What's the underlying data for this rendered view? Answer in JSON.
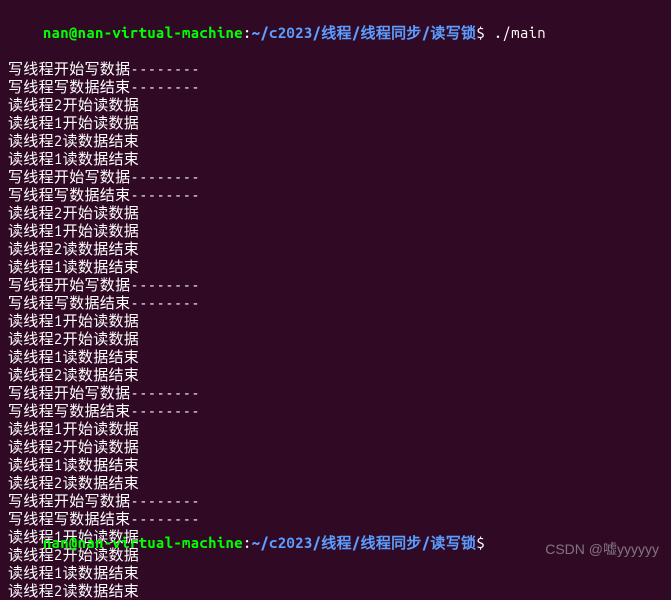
{
  "prompt": {
    "user": "nan@nan-virtual-machine",
    "sep": ":",
    "path": "~/c2023/线程/线程同步/读写锁",
    "symbol": "$",
    "command": " ./main"
  },
  "lines": [
    "写线程开始写数据--------",
    "写线程写数据结束--------",
    "读线程2开始读数据",
    "读线程1开始读数据",
    "读线程2读数据结束",
    "读线程1读数据结束",
    "写线程开始写数据--------",
    "写线程写数据结束--------",
    "读线程2开始读数据",
    "读线程1开始读数据",
    "读线程2读数据结束",
    "读线程1读数据结束",
    "写线程开始写数据--------",
    "写线程写数据结束--------",
    "读线程1开始读数据",
    "读线程2开始读数据",
    "读线程1读数据结束",
    "读线程2读数据结束",
    "写线程开始写数据--------",
    "写线程写数据结束--------",
    "读线程1开始读数据",
    "读线程2开始读数据",
    "读线程1读数据结束",
    "读线程2读数据结束",
    "写线程开始写数据--------",
    "写线程写数据结束--------",
    "读线程1开始读数据",
    "读线程2开始读数据",
    "读线程1读数据结束",
    "读线程2读数据结束"
  ],
  "bottom": {
    "user_partial": "nan@nan-virtual-machine",
    "sep": ":",
    "path_partial": "~/c2023/线程/线程同步/读写锁",
    "symbol": "$"
  },
  "watermark": "CSDN @嘘yyyyyy"
}
